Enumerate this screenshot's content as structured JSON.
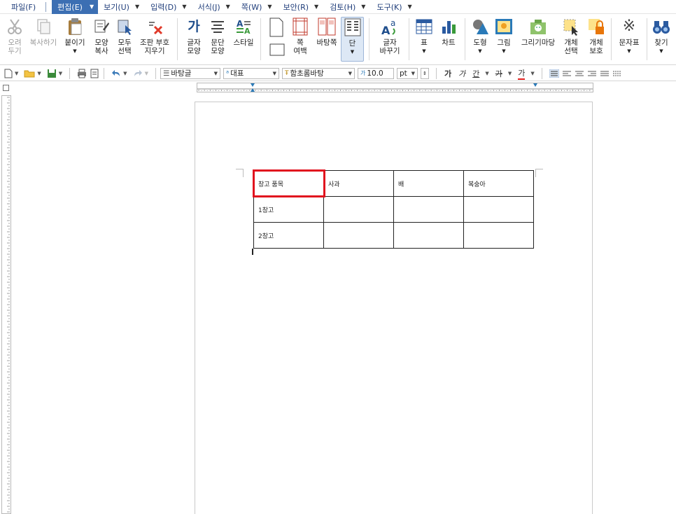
{
  "menu": [
    {
      "label": "파일(F)",
      "arrow": false
    },
    {
      "label": "편집(E)",
      "arrow": true,
      "active": true
    },
    {
      "label": "보기(U)",
      "arrow": true
    },
    {
      "label": "입력(D)",
      "arrow": true
    },
    {
      "label": "서식(J)",
      "arrow": true
    },
    {
      "label": "쪽(W)",
      "arrow": true
    },
    {
      "label": "보안(R)",
      "arrow": true
    },
    {
      "label": "검토(H)",
      "arrow": true
    },
    {
      "label": "도구(K)",
      "arrow": true
    }
  ],
  "ribbon": {
    "cut": "오려\n두기",
    "copy": "복사하기",
    "paste": "붙이기",
    "format_copy": "모양\n복사",
    "select_all": "모두\n선택",
    "clear_codes": "조판 부호\n지우기",
    "char_shape": "글자\n모양",
    "para_shape": "문단\n모양",
    "style": "스타일",
    "margin": "쪽\n여백",
    "background": "바탕쪽",
    "columns": "단",
    "replace": "글자\n바꾸기",
    "table": "표",
    "chart": "차트",
    "shape": "도형",
    "picture": "그림",
    "drawing": "그리기마당",
    "object_select": "개체\n선택",
    "object_protect": "개체\n보호",
    "char_map": "문자표",
    "find": "찾기"
  },
  "toolbar": {
    "style_combo": "바탕글",
    "lang_combo": "대표",
    "font_combo": "함초롬바탕",
    "size_combo": "10.0",
    "unit_combo": "pt",
    "bold": "가",
    "italic": "가",
    "underline": "간",
    "strike": "가",
    "color": "가"
  },
  "table": {
    "rows": [
      [
        "창고 품목",
        "사과",
        "배",
        "복숭아"
      ],
      [
        "1창고",
        "",
        "",
        ""
      ],
      [
        "2창고",
        "",
        "",
        ""
      ]
    ]
  },
  "colors": {
    "menu_text": "#1f3d7a",
    "menu_active": "#3c6fb3",
    "highlight": "#e1121e"
  }
}
